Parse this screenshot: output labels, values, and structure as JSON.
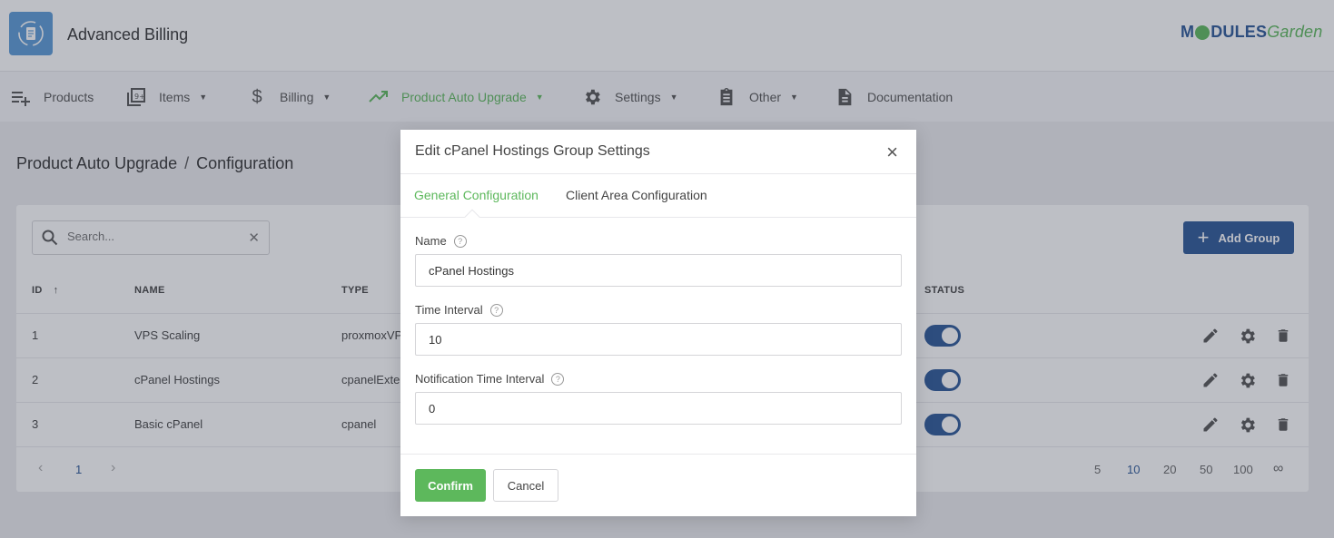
{
  "header": {
    "app_title": "Advanced Billing",
    "brand_part1": "M",
    "brand_part2": "DULES",
    "brand_part3": "Garden"
  },
  "nav": {
    "items": [
      {
        "label": "Products",
        "icon": "list-add-icon"
      },
      {
        "label": "Items",
        "icon": "library-icon"
      },
      {
        "label": "Billing",
        "icon": "dollar-icon"
      },
      {
        "label": "Product Auto Upgrade",
        "icon": "trending-up-icon"
      },
      {
        "label": "Settings",
        "icon": "gear-icon"
      },
      {
        "label": "Other",
        "icon": "clipboard-icon"
      },
      {
        "label": "Documentation",
        "icon": "document-icon"
      }
    ],
    "active": "Product Auto Upgrade"
  },
  "breadcrumb": {
    "parent": "Product Auto Upgrade",
    "separator": "/",
    "current": "Configuration"
  },
  "table": {
    "search_placeholder": "Search...",
    "add_button_label": "Add Group",
    "columns": {
      "id": "ID",
      "name": "NAME",
      "type": "TYPE",
      "status": "STATUS"
    },
    "sort_indicator": "↑",
    "rows": [
      {
        "id": "1",
        "name": "VPS Scaling",
        "type": "proxmoxVPS",
        "status_on": true
      },
      {
        "id": "2",
        "name": "cPanel Hostings",
        "type": "cpanelExtended",
        "status_on": true
      },
      {
        "id": "3",
        "name": "Basic cPanel",
        "type": "cpanel",
        "status_on": true
      }
    ],
    "pagination": {
      "current_page": "1",
      "page_sizes": [
        "5",
        "10",
        "20",
        "50",
        "100",
        "∞"
      ],
      "selected_size": "10"
    }
  },
  "modal": {
    "title": "Edit cPanel Hostings Group Settings",
    "tabs": [
      "General Configuration",
      "Client Area Configuration"
    ],
    "active_tab": "General Configuration",
    "fields": {
      "name_label": "Name",
      "name_value": "cPanel Hostings",
      "time_interval_label": "Time Interval",
      "time_interval_value": "10",
      "notification_label": "Notification Time Interval",
      "notification_value": "0"
    },
    "confirm_label": "Confirm",
    "cancel_label": "Cancel"
  },
  "colors": {
    "accent_green": "#5db85c",
    "primary_blue": "#2b5797"
  }
}
